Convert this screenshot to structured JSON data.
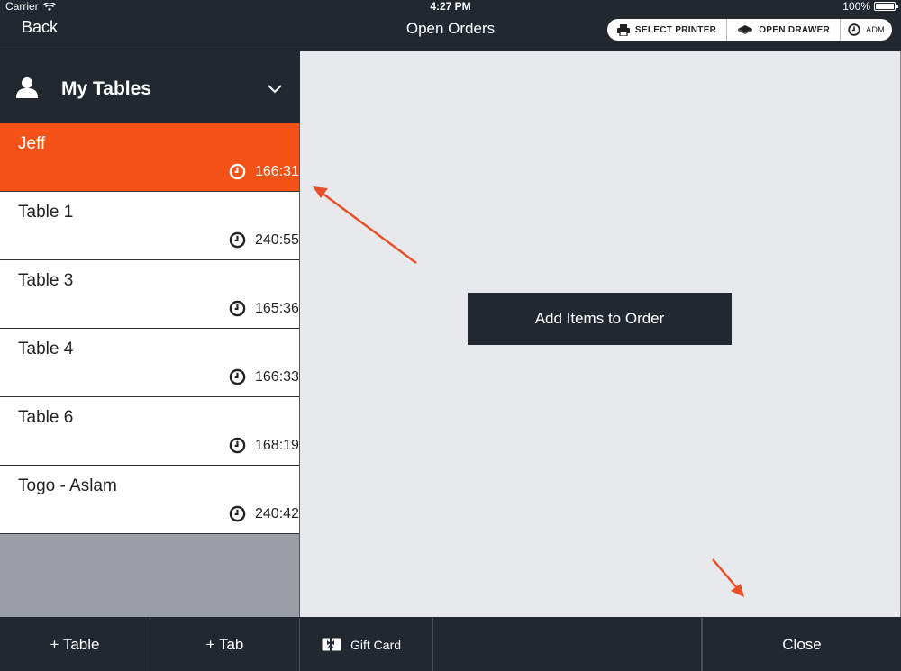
{
  "status_bar": {
    "carrier": "Carrier",
    "time": "4:27 PM",
    "battery": "100%"
  },
  "nav": {
    "back_label": "Back",
    "title": "Open Orders",
    "actions": {
      "select_printer": "SELECT PRINTER",
      "open_drawer": "OPEN DRAWER",
      "user": "ADM"
    }
  },
  "sidebar": {
    "header_title": "My Tables",
    "tables": [
      {
        "name": "Jeff",
        "time": "166:31"
      },
      {
        "name": "Table 1",
        "time": "240:55"
      },
      {
        "name": "Table 3",
        "time": "165:36"
      },
      {
        "name": "Table 4",
        "time": "166:33"
      },
      {
        "name": "Table 6",
        "time": "168:19"
      },
      {
        "name": "Togo - Aslam",
        "time": "240:42"
      }
    ]
  },
  "main": {
    "add_items_label": "Add Items to Order"
  },
  "toolbar": {
    "add_table_label": "+ Table",
    "add_tab_label": "+ Tab",
    "gift_card_label": "Gift Card",
    "close_label": "Close"
  },
  "colors": {
    "accent": "#f45116",
    "dark": "#232830",
    "panel": "#e7e9ec",
    "annotation": "#e8502a"
  }
}
